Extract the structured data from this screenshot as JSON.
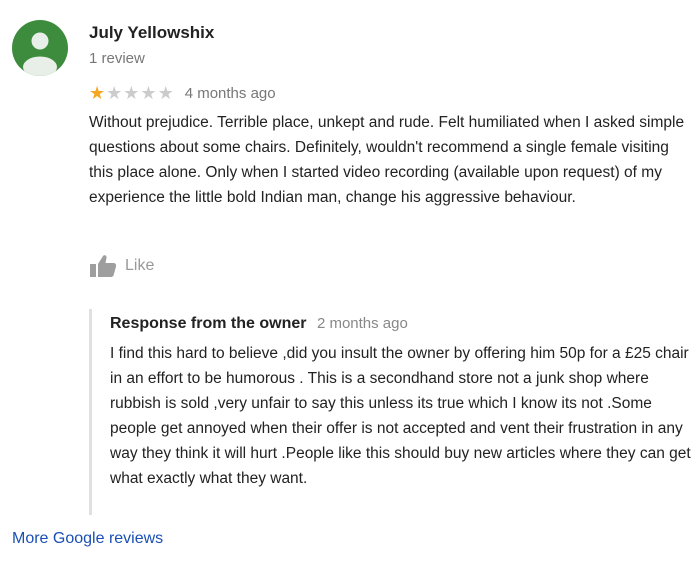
{
  "reviewer": {
    "name": "July Yellowshix",
    "review_count": "1 review",
    "avatar_color": "#3d8b3d"
  },
  "review": {
    "rating": 1,
    "max_rating": 5,
    "star_filled_color": "#f5a623",
    "star_empty_color": "#cccccc",
    "date": "4 months ago",
    "text": "Without prejudice. Terrible place, unkept and rude. Felt humiliated when I asked simple questions about some chairs. Definitely, wouldn't recommend a single female visiting this place alone. Only when I started video recording (available upon request) of my experience the little bold Indian man, change his aggressive behaviour."
  },
  "like": {
    "icon": "thumbs-up-icon",
    "label": "Like"
  },
  "owner_response": {
    "title": "Response from the owner",
    "date": "2 months ago",
    "text": "I find this hard to believe ,did you insult the owner by offering him 50p for a £25 chair in an effort to be humorous . This is a secondhand store not a junk shop where rubbish is sold ,very unfair to say this unless its true which I know its not .Some people get annoyed when their offer is not accepted and vent their frustration in any way they think it will hurt .People like this should buy new articles where they can get what exactly what they want."
  },
  "footer": {
    "more_reviews_label": "More Google reviews",
    "link_color": "#1a4fb3"
  }
}
